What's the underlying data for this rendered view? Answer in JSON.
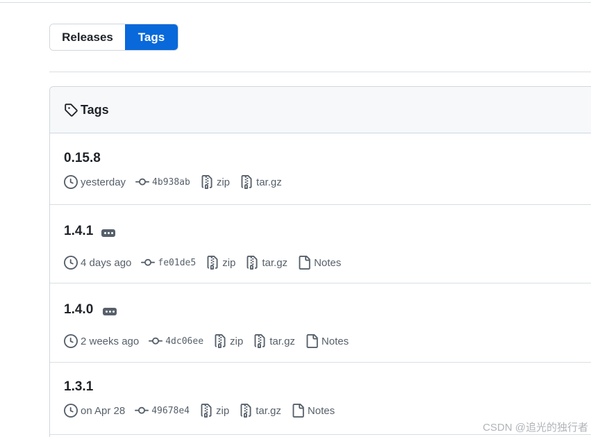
{
  "tabs": {
    "releases": "Releases",
    "tags": "Tags"
  },
  "box": {
    "title": "Tags"
  },
  "tags": [
    {
      "name": "0.15.8",
      "has_menu": false,
      "time": "yesterday",
      "sha": "4b938ab",
      "zip": "zip",
      "targz": "tar.gz",
      "notes": ""
    },
    {
      "name": "1.4.1",
      "has_menu": true,
      "time": "4 days ago",
      "sha": "fe01de5",
      "zip": "zip",
      "targz": "tar.gz",
      "notes": "Notes"
    },
    {
      "name": "1.4.0",
      "has_menu": true,
      "time": "2 weeks ago",
      "sha": "4dc06ee",
      "zip": "zip",
      "targz": "tar.gz",
      "notes": "Notes"
    },
    {
      "name": "1.3.1",
      "has_menu": false,
      "time": "on Apr 28",
      "sha": "49678e4",
      "zip": "zip",
      "targz": "tar.gz",
      "notes": "Notes"
    }
  ],
  "watermark": "CSDN @追光的独行者",
  "colors": {
    "accent": "#0969da",
    "muted": "#57606a",
    "border": "#d0d7de",
    "header_bg": "#f6f8fa"
  },
  "icons": {
    "header": "tag-icon",
    "time": "clock-icon",
    "commit": "commit-icon",
    "zip": "file-zip-icon",
    "targz": "file-zip-icon",
    "notes": "file-icon",
    "menu": "kebab-horizontal-icon"
  }
}
